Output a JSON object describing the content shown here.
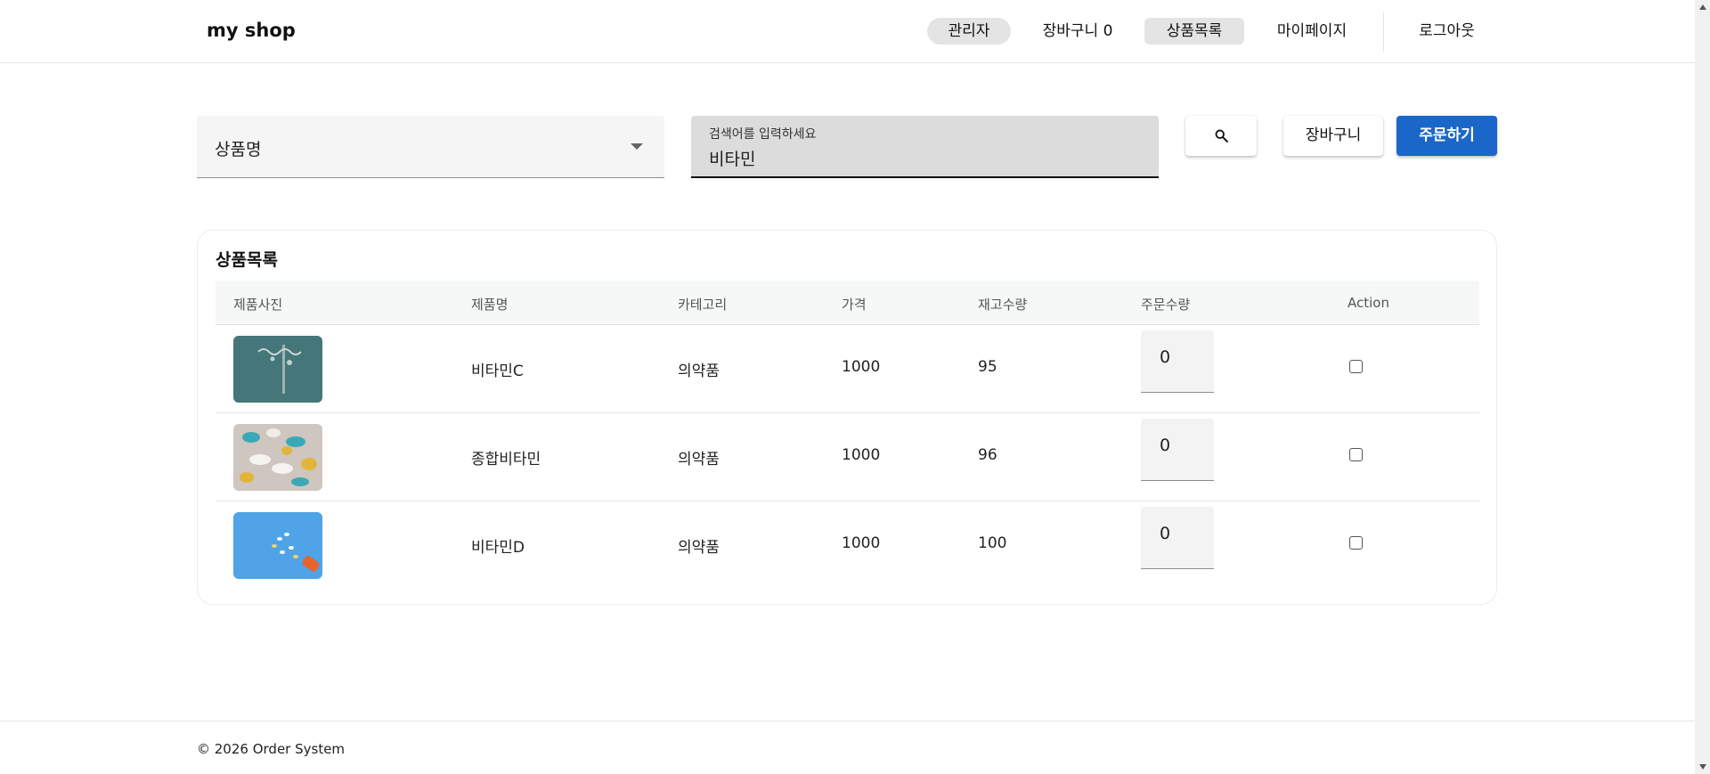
{
  "header": {
    "brand": "my shop",
    "nav": {
      "admin": "관리자",
      "cart": "장바구니 0",
      "products": "상품목록",
      "mypage": "마이페이지",
      "logout": "로그아웃"
    }
  },
  "search": {
    "select_value": "상품명",
    "input_label": "검색어를 입력하세요",
    "input_value": "비타민",
    "cart_button": "장바구니",
    "order_button": "주문하기",
    "icon": "search-icon"
  },
  "products": {
    "title": "상품목록",
    "columns": [
      "제품사진",
      "제품명",
      "카테고리",
      "가격",
      "재고수량",
      "주문수량",
      "Action"
    ],
    "rows": [
      {
        "name": "비타민C",
        "category": "의약품",
        "price": "1000",
        "stock": "95",
        "qty": "0"
      },
      {
        "name": "종합비타민",
        "category": "의약품",
        "price": "1000",
        "stock": "96",
        "qty": "0"
      },
      {
        "name": "비타민D",
        "category": "의약품",
        "price": "1000",
        "stock": "100",
        "qty": "0"
      }
    ]
  },
  "footer": {
    "text": "© 2026 Order System"
  },
  "colors": {
    "primary": "#1a67c9",
    "nav_active": "#e4e4e4"
  }
}
